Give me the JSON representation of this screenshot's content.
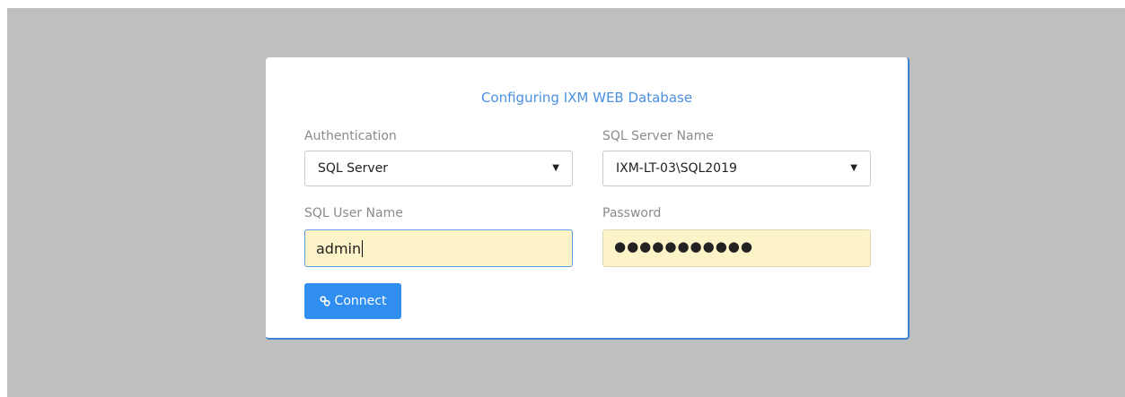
{
  "dialog": {
    "title": "Configuring IXM WEB Database"
  },
  "form": {
    "authentication": {
      "label": "Authentication",
      "value": "SQL Server"
    },
    "server_name": {
      "label": "SQL Server Name",
      "value": "IXM-LT-03\\SQL2019"
    },
    "user_name": {
      "label": "SQL User Name",
      "value": "admin"
    },
    "password": {
      "label": "Password",
      "value": "●●●●●●●●●●●"
    }
  },
  "actions": {
    "connect_label": "Connect",
    "connect_icon": "link-icon"
  },
  "colors": {
    "accent": "#2f8ef0",
    "title": "#4a90e2",
    "autofill_bg": "#fcf3c8",
    "backdrop": "#bfbfbf"
  }
}
